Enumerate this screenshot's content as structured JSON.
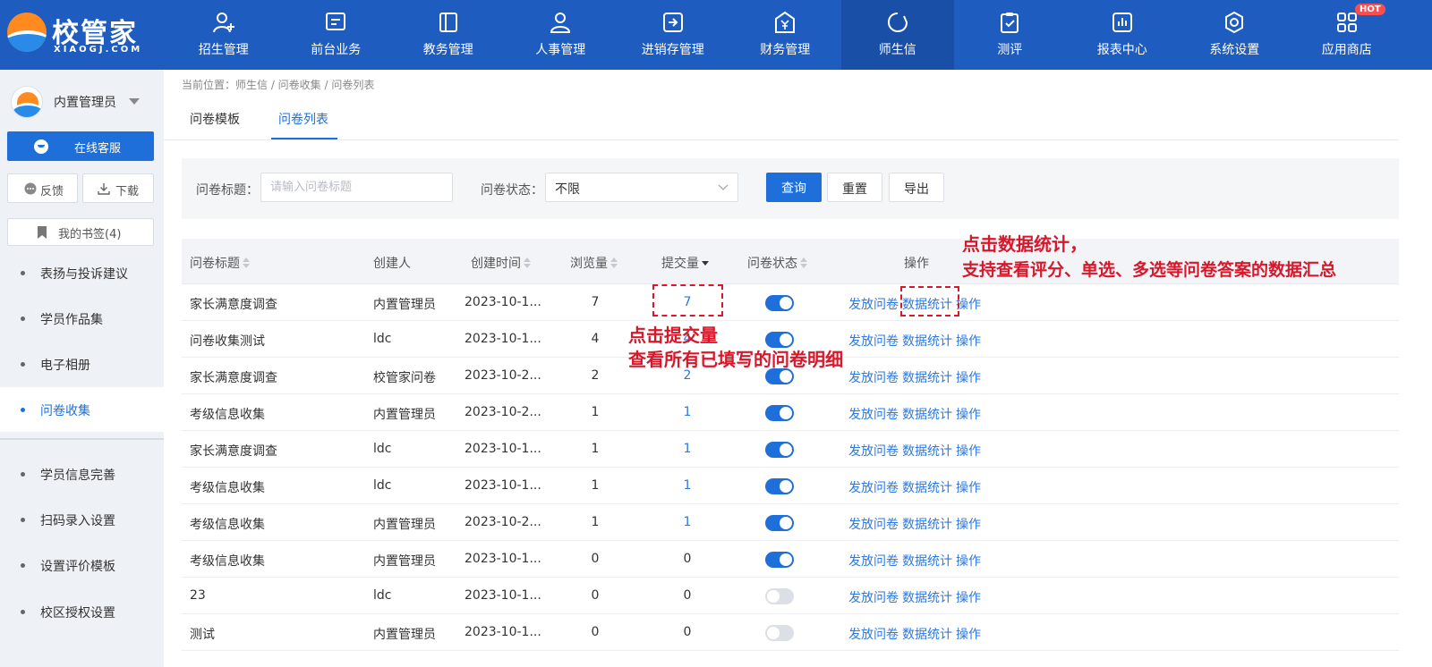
{
  "logo": {
    "text": "校管家",
    "sub": "XIAOGJ.COM"
  },
  "nav": [
    {
      "label": "招生管理",
      "icon": "user-add-icon"
    },
    {
      "label": "前台业务",
      "icon": "monitor-icon"
    },
    {
      "label": "教务管理",
      "icon": "book-icon"
    },
    {
      "label": "人事管理",
      "icon": "person-icon"
    },
    {
      "label": "进销存管理",
      "icon": "inventory-icon"
    },
    {
      "label": "财务管理",
      "icon": "money-icon"
    },
    {
      "label": "师生信",
      "icon": "message-icon",
      "active": true
    },
    {
      "label": "测评",
      "icon": "clipboard-icon"
    },
    {
      "label": "报表中心",
      "icon": "chart-icon"
    },
    {
      "label": "系统设置",
      "icon": "settings-icon"
    },
    {
      "label": "应用商店",
      "icon": "apps-icon",
      "badge": "HOT"
    }
  ],
  "sidebar": {
    "user_name": "内置管理员",
    "service_label": "在线客服",
    "feedback_label": "反馈",
    "download_label": "下载",
    "bookmark_label": "我的书签(4)",
    "menu": [
      {
        "label": "表扬与投诉建议"
      },
      {
        "label": "学员作品集"
      },
      {
        "label": "电子相册"
      },
      {
        "label": "问卷收集",
        "active": true
      },
      {
        "label": "学员信息完善"
      },
      {
        "label": "扫码录入设置"
      },
      {
        "label": "设置评价模板"
      },
      {
        "label": "校区授权设置"
      }
    ]
  },
  "breadcrumb": "当前位置：师生信 / 问卷收集 / 问卷列表",
  "tabs": [
    {
      "label": "问卷模板"
    },
    {
      "label": "问卷列表",
      "active": true
    }
  ],
  "filter": {
    "title_label": "问卷标题：",
    "title_placeholder": "请输入问卷标题",
    "status_label": "问卷状态：",
    "status_value": "不限",
    "query_label": "查询",
    "reset_label": "重置",
    "export_label": "导出"
  },
  "table": {
    "headers": {
      "title": "问卷标题",
      "creator": "创建人",
      "created": "创建时间",
      "views": "浏览量",
      "submits": "提交量",
      "status": "问卷状态",
      "actions": "操作"
    },
    "action_labels": {
      "publish": "发放问卷",
      "stats": "数据统计",
      "ops": "操作"
    },
    "rows": [
      {
        "title": "家长满意度调查",
        "creator": "内置管理员",
        "created": "2023-10-1...",
        "views": "7",
        "submits": "7",
        "status_on": true
      },
      {
        "title": "问卷收集测试",
        "creator": "ldc",
        "created": "2023-10-1...",
        "views": "4",
        "submits": "4",
        "status_on": true
      },
      {
        "title": "家长满意度调查",
        "creator": "校管家问卷",
        "created": "2023-10-2...",
        "views": "2",
        "submits": "2",
        "status_on": true
      },
      {
        "title": "考级信息收集",
        "creator": "内置管理员",
        "created": "2023-10-2...",
        "views": "1",
        "submits": "1",
        "status_on": true
      },
      {
        "title": "家长满意度调查",
        "creator": "ldc",
        "created": "2023-10-1...",
        "views": "1",
        "submits": "1",
        "status_on": true
      },
      {
        "title": "考级信息收集",
        "creator": "ldc",
        "created": "2023-10-1...",
        "views": "1",
        "submits": "1",
        "status_on": true
      },
      {
        "title": "考级信息收集",
        "creator": "内置管理员",
        "created": "2023-10-2...",
        "views": "1",
        "submits": "1",
        "status_on": true
      },
      {
        "title": "考级信息收集",
        "creator": "内置管理员",
        "created": "2023-10-1...",
        "views": "0",
        "submits": "0",
        "status_on": true
      },
      {
        "title": "23",
        "creator": "ldc",
        "created": "2023-10-1...",
        "views": "0",
        "submits": "0",
        "status_on": false
      },
      {
        "title": "测试",
        "creator": "内置管理员",
        "created": "2023-10-1...",
        "views": "0",
        "submits": "0",
        "status_on": false
      }
    ]
  },
  "annotations": {
    "stats_line1": "点击数据统计，",
    "stats_line2": "支持查看评分、单选、多选等问卷答案的数据汇总",
    "submit_line1": "点击提交量",
    "submit_line2": "查看所有已填写的问卷明细"
  },
  "colors": {
    "brand": "#1f5cc0",
    "accent": "#1e6fd9",
    "annotation": "#d8172b"
  }
}
